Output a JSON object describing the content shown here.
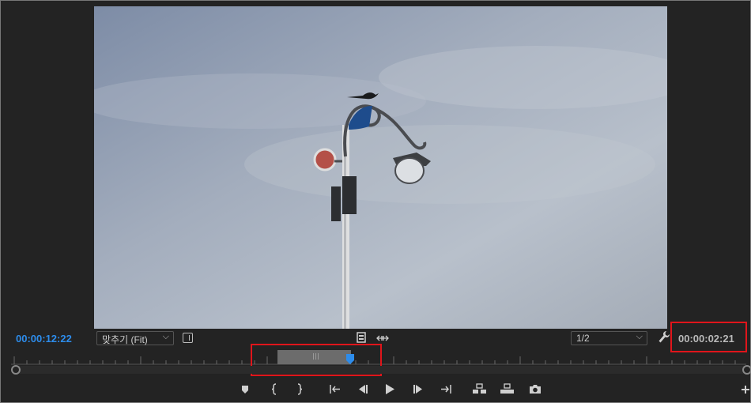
{
  "monitor": {
    "current_timecode": "00:00:12:22",
    "duration_timecode": "00:00:02:21",
    "zoom": {
      "selected": "맞추기 (Fit)"
    },
    "resolution": {
      "selected": "1/2"
    }
  },
  "transport": {
    "buttons": [
      {
        "name": "add-marker",
        "icon": "marker-icon"
      },
      {
        "name": "mark-in",
        "icon": "mark-in-icon"
      },
      {
        "name": "mark-out",
        "icon": "mark-out-icon"
      },
      {
        "name": "go-to-in",
        "icon": "go-to-in-icon"
      },
      {
        "name": "step-back",
        "icon": "step-back-icon"
      },
      {
        "name": "play",
        "icon": "play-icon"
      },
      {
        "name": "step-forward",
        "icon": "step-forward-icon"
      },
      {
        "name": "go-to-out",
        "icon": "go-to-out-icon"
      },
      {
        "name": "insert",
        "icon": "insert-icon"
      },
      {
        "name": "overwrite",
        "icon": "overwrite-icon"
      },
      {
        "name": "export-frame",
        "icon": "camera-icon"
      },
      {
        "name": "button-editor",
        "icon": "plus-icon"
      }
    ]
  },
  "colors": {
    "timecode_accent": "#2d8ceb",
    "highlight": "#e0151b",
    "background": "#232323"
  }
}
